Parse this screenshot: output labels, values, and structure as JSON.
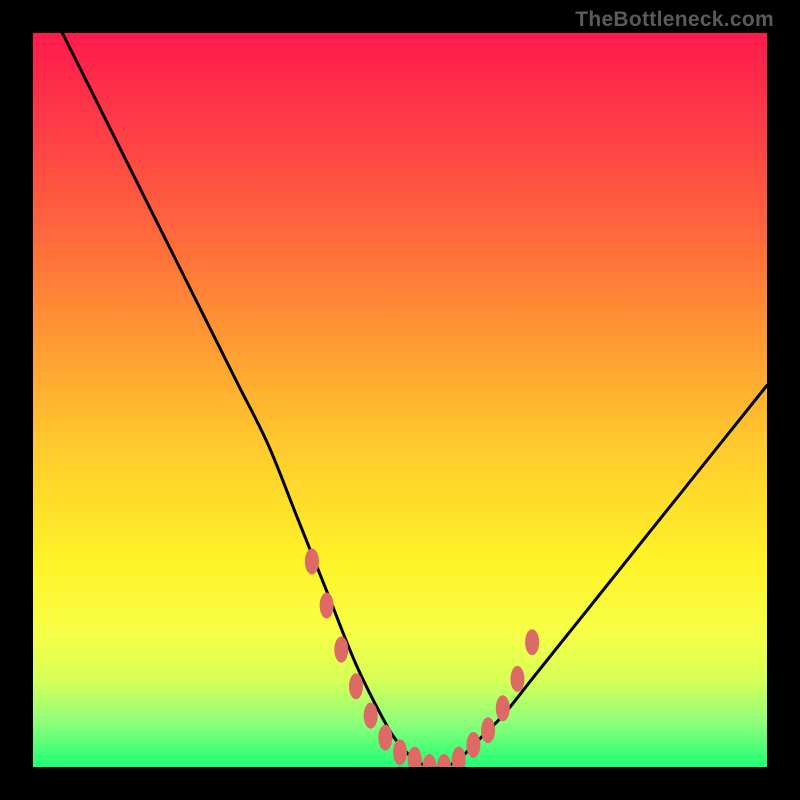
{
  "watermark": "TheBottleneck.com",
  "colors": {
    "background": "#000000",
    "curve": "#000000",
    "marker": "#dd6a64",
    "gradient_top": "#ff1a4d",
    "gradient_bottom": "#1eff76"
  },
  "chart_data": {
    "type": "line",
    "title": "",
    "xlabel": "",
    "ylabel": "",
    "xlim": [
      0,
      100
    ],
    "ylim": [
      0,
      100
    ],
    "series": [
      {
        "name": "bottleneck-curve",
        "x": [
          4,
          8,
          12,
          16,
          20,
          24,
          28,
          32,
          36,
          40,
          44,
          48,
          50,
          52,
          54,
          56,
          58,
          60,
          64,
          68,
          72,
          76,
          80,
          84,
          88,
          92,
          96,
          100
        ],
        "y": [
          100,
          92,
          84,
          76,
          68,
          60,
          52,
          44,
          34,
          24,
          14,
          6,
          3,
          1,
          0,
          0,
          1,
          3,
          7,
          12,
          17,
          22,
          27,
          32,
          37,
          42,
          47,
          52
        ]
      }
    ],
    "markers": {
      "name": "highlight-dots",
      "x": [
        38,
        40,
        42,
        44,
        46,
        48,
        50,
        52,
        54,
        56,
        58,
        60,
        62,
        64,
        66,
        68
      ],
      "y": [
        28,
        22,
        16,
        11,
        7,
        4,
        2,
        1,
        0,
        0,
        1,
        3,
        5,
        8,
        12,
        17
      ]
    }
  }
}
